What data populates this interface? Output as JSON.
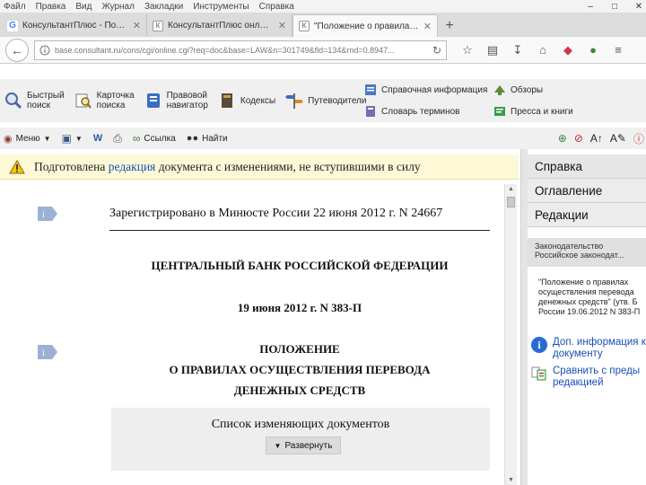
{
  "browser": {
    "menu": [
      "Файл",
      "Правка",
      "Вид",
      "Журнал",
      "Закладки",
      "Инструменты",
      "Справка"
    ],
    "tabs": [
      {
        "label": "КонсультантПлюс - Поиск...",
        "icon": "google-favicon",
        "active": false
      },
      {
        "label": "КонсультантПлюс онлайн...",
        "icon": "consultant-favicon",
        "active": false
      },
      {
        "label": "\"Положение о правилах...",
        "icon": "consultant-favicon",
        "active": true
      }
    ],
    "address": "base.consultant.ru/cons/cgi/online.cgi?req=doc&base=LAW&n=301749&fld=134&rnd=0.8947..."
  },
  "toolbar": {
    "buttons": [
      {
        "label": "Быстрый\nпоиск",
        "icon": "magnifier-icon"
      },
      {
        "label": "Карточка\nпоиска",
        "icon": "search-card-icon"
      },
      {
        "label": "Правовой\nнавигатор",
        "icon": "navigator-icon"
      },
      {
        "label": "Кодексы",
        "icon": "codex-book-icon"
      },
      {
        "label": "Путеводители",
        "icon": "signpost-icon"
      }
    ],
    "right_buttons": [
      {
        "label": "Справочная информация",
        "icon": "reference-icon"
      },
      {
        "label": "Обзоры",
        "icon": "reviews-icon"
      },
      {
        "label": "Словарь терминов",
        "icon": "dictionary-icon"
      },
      {
        "label": "Пресса и книги",
        "icon": "press-icon"
      }
    ]
  },
  "secondary_toolbar": {
    "menu_label": "Меню",
    "link_label": "Ссылка",
    "find_label": "Найти"
  },
  "notice": {
    "prefix": "Подготовлена",
    "link": "редакция",
    "suffix": "документа с изменениями, не вступившими в силу"
  },
  "document": {
    "registration": "Зарегистрировано в Минюсте России 22 июня 2012 г. N 24667",
    "issuer": "ЦЕНТРАЛЬНЫЙ БАНК РОССИЙСКОЙ ФЕДЕРАЦИИ",
    "date_number": "19 июня 2012 г. N 383-П",
    "doc_type": "ПОЛОЖЕНИЕ",
    "title_line1": "О ПРАВИЛАХ ОСУЩЕСТВЛЕНИЯ ПЕРЕВОДА",
    "title_line2": "ДЕНЕЖНЫХ СРЕДСТВ",
    "changes_title": "Список изменяющих документов",
    "expand_label": "Развернуть"
  },
  "side_panel": {
    "tabs": [
      "Справка",
      "Оглавление",
      "Редакции"
    ],
    "legislation_header": "Законодательство",
    "legislation_sub": "Российское законодат...",
    "doc_card": "\"Положение о правилах\nосуществления перевода\nденежных средств\" (утв. Б\nРоссии 19.06.2012 N 383-П",
    "actions": [
      {
        "label": "Доп. информация к\nдокументу",
        "icon": "info-icon"
      },
      {
        "label": "Сравнить с преды\nредакцией",
        "icon": "compare-icon"
      }
    ]
  },
  "colors": {
    "notice_bg": "#fdf8d6",
    "link": "#1a4fb5",
    "panel_bg": "#ececec"
  }
}
